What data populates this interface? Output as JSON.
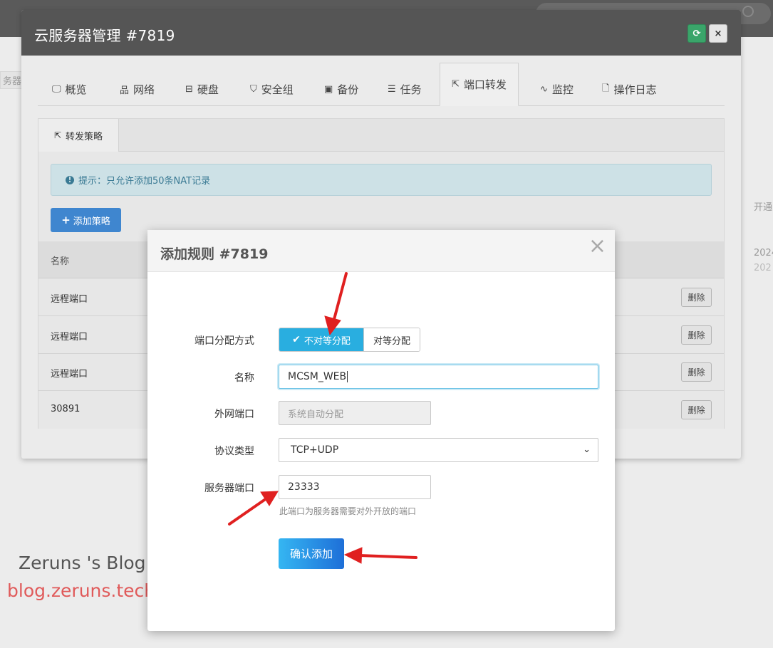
{
  "colors": {
    "header": "#555555",
    "accent": "#29aee0",
    "primary": "#3f86cf",
    "annotation": "#e02020",
    "watermark_red": "#e05a5a"
  },
  "background": {
    "side_text": "务器",
    "right_text_1": "开通",
    "right_text_2": "2024",
    "right_text_3": "202"
  },
  "window": {
    "title": "云服务器管理 #7819",
    "refresh_icon": "refresh-icon",
    "close_label": "×",
    "tabs": [
      {
        "label": "概览",
        "icon": "monitor-icon"
      },
      {
        "label": "网络",
        "icon": "network-icon"
      },
      {
        "label": "硬盘",
        "icon": "disk-icon"
      },
      {
        "label": "安全组",
        "icon": "shield-icon"
      },
      {
        "label": "备份",
        "icon": "save-icon"
      },
      {
        "label": "任务",
        "icon": "tasks-icon"
      },
      {
        "label": "端口转发",
        "icon": "external-link-icon",
        "active": true
      },
      {
        "label": "监控",
        "icon": "heartbeat-icon"
      },
      {
        "label": "操作日志",
        "icon": "file-icon"
      }
    ]
  },
  "panel": {
    "tab_label": "转发策略",
    "alert_text": "提示：只允许添加50条NAT记录",
    "add_button": "添加策略",
    "table": {
      "header_name": "名称",
      "rows": [
        {
          "name": "远程端口",
          "action": "删除"
        },
        {
          "name": "远程端口",
          "action": "删除"
        },
        {
          "name": "远程端口",
          "action": "删除"
        },
        {
          "name": "30891",
          "action": "删除"
        }
      ]
    }
  },
  "modal": {
    "title": "添加规则 #7819",
    "close": "×",
    "fields": {
      "allocation_label": "端口分配方式",
      "allocation_options": [
        "不对等分配",
        "对等分配"
      ],
      "allocation_selected": "不对等分配",
      "name_label": "名称",
      "name_value": "MCSM_WEB",
      "external_port_label": "外网端口",
      "external_port_placeholder": "系统自动分配",
      "protocol_label": "协议类型",
      "protocol_value": "TCP+UDP",
      "server_port_label": "服务器端口",
      "server_port_value": "23333",
      "server_port_help": "此端口为服务器需要对外开放的端口"
    },
    "submit": "确认添加"
  },
  "watermark": {
    "line1": "Zeruns 's Blog",
    "line2": "blog.zeruns.tech"
  }
}
